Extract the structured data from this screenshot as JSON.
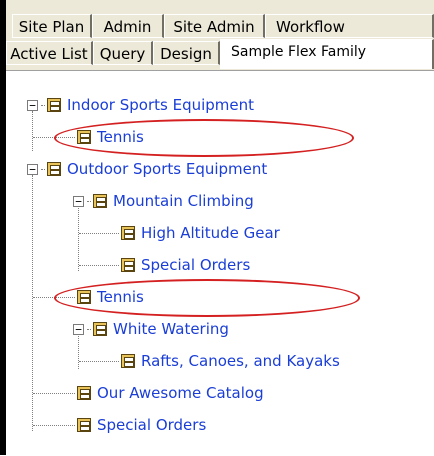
{
  "tabs": {
    "row1": [
      "Site Plan",
      "Admin",
      "Site Admin",
      "Workflow"
    ],
    "row2": [
      "Active List",
      "Query",
      "Design",
      "Sample Flex Family"
    ]
  },
  "tree": {
    "indoor": "Indoor Sports Equipment",
    "indoor_tennis": "Tennis",
    "outdoor": "Outdoor Sports Equipment",
    "mountain": "Mountain Climbing",
    "high_altitude": "High Altitude Gear",
    "special_orders_mc": "Special Orders",
    "outdoor_tennis": "Tennis",
    "white_watering": "White Watering",
    "rafts": "Rafts, Canoes, and Kayaks",
    "catalog": "Our Awesome Catalog",
    "special_orders": "Special Orders"
  },
  "icons": {
    "node": "catalog-node-icon",
    "expander": "collapse-minus-icon"
  },
  "colors": {
    "link": "#1a3ed6",
    "highlight": "#d42020"
  }
}
